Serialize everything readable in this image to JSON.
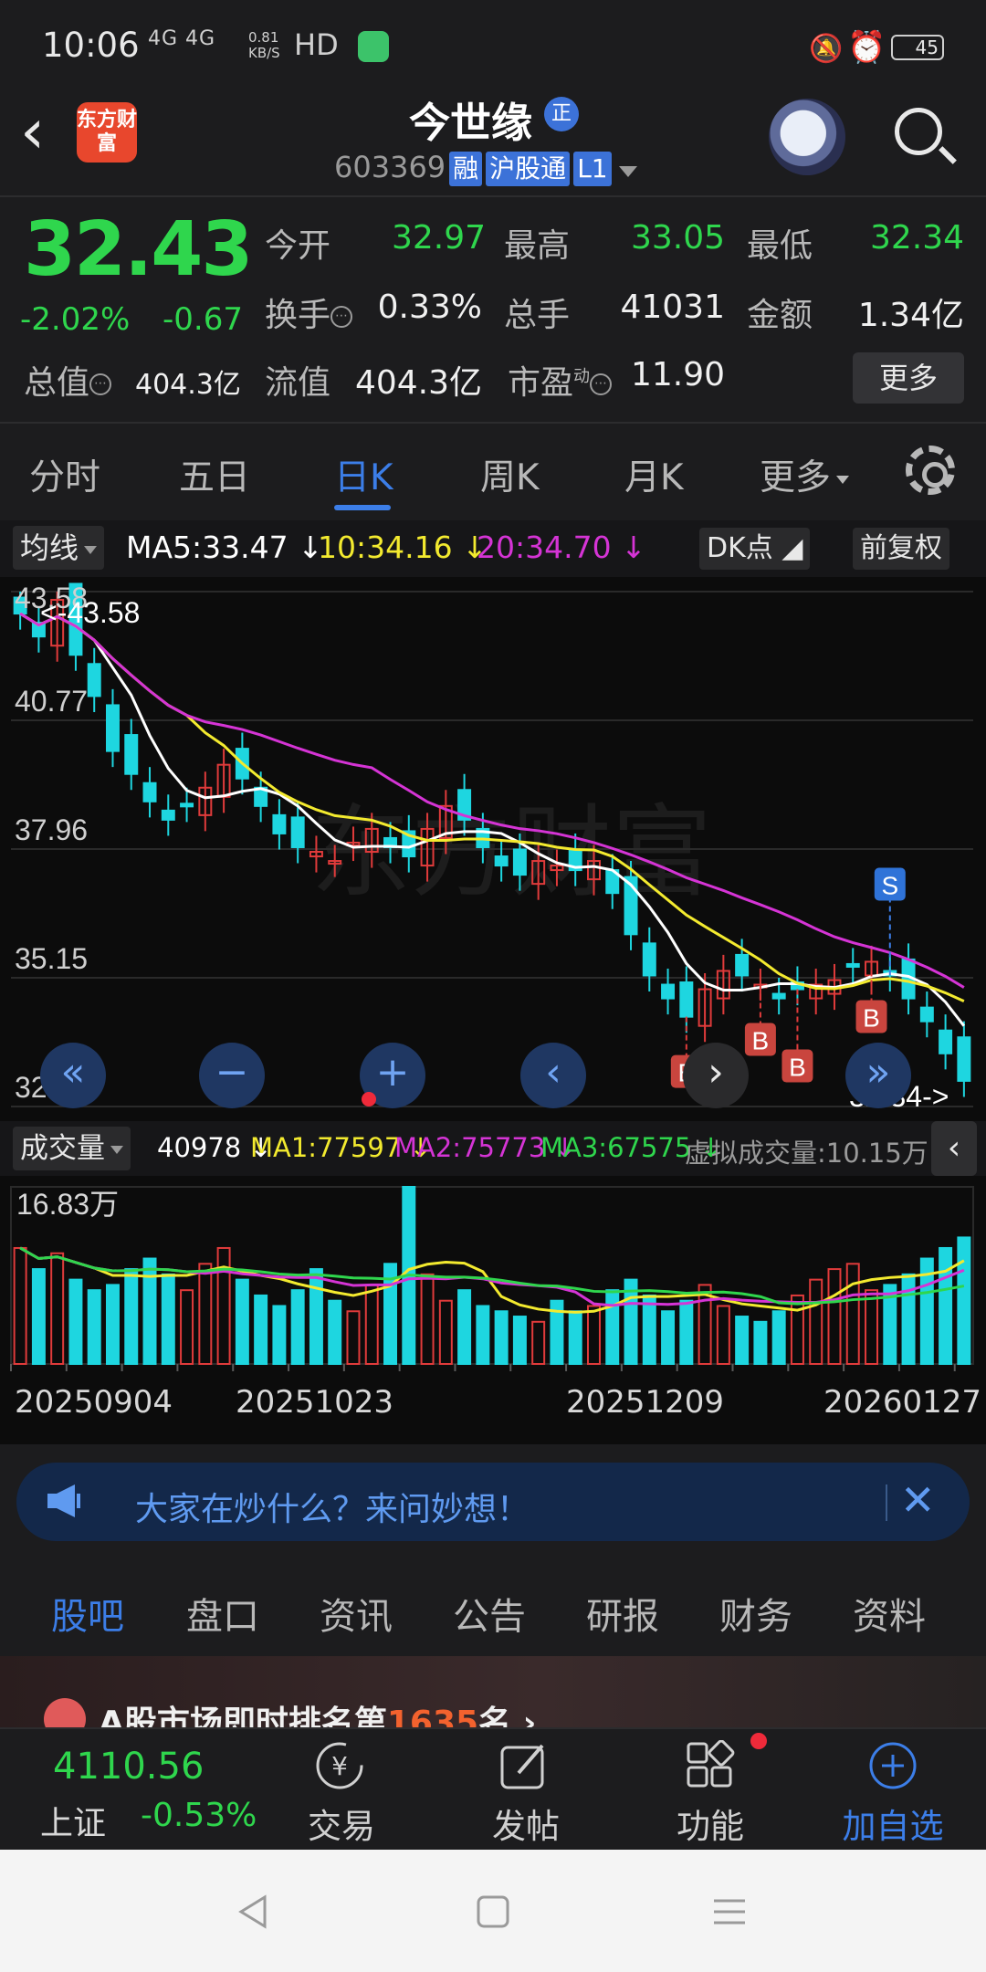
{
  "status_bar": {
    "time": "10:06",
    "network": "4G 4G",
    "speed_value": "0.81",
    "speed_unit": "KB/S",
    "hd": "HD",
    "battery": "45"
  },
  "header": {
    "logo_text": "东方财富",
    "stock_name": "今世缘",
    "badge": "正",
    "code": "603369",
    "tags": [
      "融",
      "沪股通",
      "L1"
    ]
  },
  "quote": {
    "price": "32.43",
    "change_pct": "-2.02%",
    "change_val": "-0.67",
    "rows": [
      [
        {
          "label": "今开",
          "value": "32.97"
        },
        {
          "label": "最高",
          "value": "33.05"
        },
        {
          "label": "最低",
          "value": "32.34"
        }
      ],
      [
        {
          "label": "换手",
          "value": "0.33%"
        },
        {
          "label": "总手",
          "value": "41031"
        },
        {
          "label": "金额",
          "value": "1.34亿"
        }
      ],
      [
        {
          "label": "总值",
          "value": "404.3亿"
        },
        {
          "label": "流值",
          "value": "404.3亿"
        },
        {
          "label": "市盈",
          "sup": "动",
          "value": "11.90"
        }
      ]
    ],
    "more_btn": "更多"
  },
  "period_tabs": {
    "items": [
      "分时",
      "五日",
      "日K",
      "周K",
      "月K",
      "更多"
    ],
    "active": "日K"
  },
  "kline": {
    "indicator_chip": "均线",
    "ma5": "MA5:33.47 ↓",
    "ma10": "10:34.16 ↓",
    "ma20": "20:34.70 ↓",
    "dk_chip": "DK点",
    "adjust_chip": "前复权",
    "watermark": "东方财富",
    "high_label": "<-43.58",
    "low_label": "32.34->",
    "y_ticks": [
      "43.58",
      "40.77",
      "37.96",
      "35.15",
      "32.34"
    ],
    "signals": [
      {
        "text": "B"
      },
      {
        "text": "B"
      },
      {
        "text": "B"
      },
      {
        "text": "B"
      },
      {
        "text": "S"
      }
    ]
  },
  "volume": {
    "chip": "成交量",
    "value": "40978 ↓",
    "ma1": "MA1:77597 ↓",
    "ma2": "MA2:75773 ↓",
    "ma3": "MA3:67575 ↓",
    "virtual": "虚拟成交量:10.15万",
    "max_label": "16.83万",
    "dates": [
      "20250904",
      "20251023",
      "20251209",
      "20260127"
    ]
  },
  "chart_data": [
    {
      "type": "candlestick",
      "title": "",
      "ylim": [
        32.34,
        43.58
      ],
      "y_ticks": [
        43.58,
        40.77,
        37.96,
        35.15,
        32.34
      ],
      "series": [
        {
          "name": "MA5",
          "last": 33.47
        },
        {
          "name": "10",
          "last": 34.16
        },
        {
          "name": "20",
          "last": 34.7
        }
      ],
      "price_path": [
        43.1,
        42.6,
        43.4,
        42.2,
        41.3,
        40.1,
        39.6,
        39.0,
        38.6,
        38.9,
        39.3,
        39.8,
        39.5,
        38.9,
        38.3,
        38.0,
        37.9,
        37.7,
        38.1,
        38.4,
        38.0,
        37.8,
        38.4,
        38.9,
        38.6,
        38.0,
        37.6,
        37.4,
        37.7,
        37.6,
        37.5,
        37.7,
        37.0,
        36.1,
        35.2,
        34.7,
        34.3,
        34.9,
        35.3,
        35.2,
        35.0,
        34.7,
        34.9,
        35.0,
        35.1,
        35.4,
        35.5,
        35.2,
        34.7,
        34.2,
        33.5,
        32.9
      ]
    },
    {
      "type": "bar",
      "title": "",
      "ylim": [
        0,
        168300
      ],
      "dates": [
        "20250904",
        "20251023",
        "20251209",
        "20260127"
      ],
      "volume_path": [
        110,
        90,
        105,
        80,
        70,
        75,
        90,
        100,
        85,
        70,
        95,
        110,
        80,
        65,
        55,
        70,
        90,
        60,
        50,
        75,
        95,
        168,
        85,
        60,
        70,
        55,
        50,
        45,
        40,
        60,
        50,
        55,
        70,
        80,
        65,
        50,
        60,
        75,
        55,
        45,
        40,
        50,
        65,
        80,
        90,
        95,
        70,
        75,
        85,
        100,
        110,
        120
      ],
      "series": [
        {
          "name": "MA1",
          "last": 77597
        },
        {
          "name": "MA2",
          "last": 75773
        },
        {
          "name": "MA3",
          "last": 67575
        }
      ]
    }
  ],
  "banner": {
    "text": "大家在炒什么？来问妙想！"
  },
  "section_tabs": {
    "items": [
      "股吧",
      "盘口",
      "资讯",
      "公告",
      "研报",
      "财务",
      "资料"
    ],
    "active": "股吧"
  },
  "rank": {
    "prefix": "A股市场即时排名第",
    "num": "1635",
    "suffix": "名"
  },
  "bottom_nav": {
    "index_value": "4110.56",
    "index_name": "上证",
    "index_pct": "-0.53%",
    "items": [
      "交易",
      "发帖",
      "功能",
      "加自选"
    ]
  },
  "colors": {
    "up": "#e03b3b",
    "down": "#2fd64d",
    "accent": "#3c7ee8",
    "ma5": "#ffffff",
    "ma10": "#f3ea2f",
    "ma20": "#d534d5"
  }
}
